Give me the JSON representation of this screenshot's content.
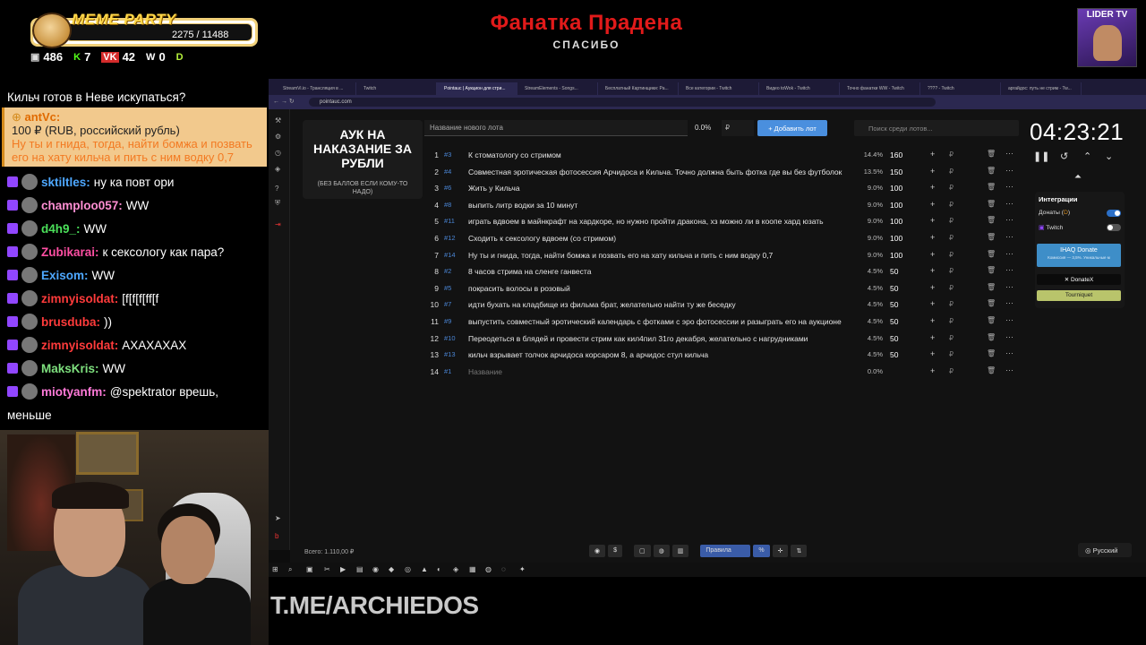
{
  "overlay": {
    "meme_title": "MEME PARTY",
    "meme_count": "2275 / 11488",
    "stats": [
      {
        "icon": "chat-icon",
        "value": "486"
      },
      {
        "icon": "kick-icon",
        "value": "7"
      },
      {
        "icon": "vk-icon",
        "value": "42"
      },
      {
        "icon": "w-icon",
        "value": "0"
      }
    ],
    "title": "Фанатка Прадена",
    "subtitle": "СПАСИБО",
    "channel": "LIDER TV",
    "watermark": "T.ME/ARCHIEDOS"
  },
  "chat": {
    "top_line": "Кильч готов в Неве искупаться?",
    "donation": {
      "name": "antVc:",
      "amount": "100 ₽ (RUB, российский рубль)",
      "message": "Ну ты и гнида, тогда, найти бомжа и позвать его на хату кильча и пить с ним водку 0,7"
    },
    "messages": [
      {
        "name": "sktiltles:",
        "color": "#4ea8ff",
        "text": "ну ка повт ори"
      },
      {
        "name": "champloo057:",
        "color": "#ff8fd3",
        "text": "WW"
      },
      {
        "name": "d4h9_:",
        "color": "#4be05a",
        "text": "WW"
      },
      {
        "name": "Zubikarai:",
        "color": "#ff4fa3",
        "text": "к сексологу как пара?"
      },
      {
        "name": "Exisom:",
        "color": "#4ea8ff",
        "text": "WW"
      },
      {
        "name": "zimnyisoldat:",
        "color": "#ff3b3b",
        "text": "[f[f[f[ff[f"
      },
      {
        "name": "brusduba:",
        "color": "#ff3b3b",
        "text": "))"
      },
      {
        "name": "zimnyisoldat:",
        "color": "#ff3b3b",
        "text": "АХАХАХАХ"
      },
      {
        "name": "MaksKris:",
        "color": "#7ee07e",
        "text": "WW"
      },
      {
        "name": "miotyanfm:",
        "color": "#ff7ad9",
        "text": "@spektrator врешь,"
      }
    ],
    "tail": "меньше"
  },
  "browser": {
    "tabs": [
      "StreamVi.io - Трансляция в ...",
      "Twitch",
      "Pointauc | Аукцион для стри...",
      "StreamElements - Songs...",
      "Бесплатный Картинщики: Ра...",
      "Все категории - Twitch",
      "Видео toWok - Twitch",
      "Точно фанатки WW - Twitch",
      "???? - Twitch",
      "аргайдос: путь не стрим - Tw..."
    ],
    "url": "pointauc.com"
  },
  "auction": {
    "card_title": "АУК НА НАКАЗАНИЕ ЗА РУБЛИ",
    "card_sub": "(БЕЗ БАЛЛОВ ЕСЛИ КОМУ-ТО НАДО)",
    "new_lot_placeholder": "Название нового лота",
    "percent": "0.0%",
    "currency": "₽",
    "add_button": "Добавить лот",
    "search_placeholder": "Поиск среди лотов...",
    "lots": [
      {
        "n": "1",
        "id": "#3",
        "title": "К стоматологу со стримом",
        "pct": "14.4%",
        "amount": "160"
      },
      {
        "n": "2",
        "id": "#4",
        "title": "Совместная эротическая фотосессия Арчидоса и Кильча. Точно должна быть фотка где вы без футболок",
        "pct": "13.5%",
        "amount": "150"
      },
      {
        "n": "3",
        "id": "#6",
        "title": "Жить у Кильча",
        "pct": "9.0%",
        "amount": "100"
      },
      {
        "n": "4",
        "id": "#8",
        "title": "выпить литр водки за 10 минут",
        "pct": "9.0%",
        "amount": "100"
      },
      {
        "n": "5",
        "id": "#11",
        "title": "играть вдвоем в майнкрафт на хардкоре, но нужно пройти дракона, хз можно ли в коопе хард юзать",
        "pct": "9.0%",
        "amount": "100"
      },
      {
        "n": "6",
        "id": "#12",
        "title": "Сходить к сексологу вдвоем (со стримом)",
        "pct": "9.0%",
        "amount": "100"
      },
      {
        "n": "7",
        "id": "#14",
        "title": "Ну ты и гнида, тогда, найти бомжа и позвать его на хату кильча и пить с ним водку 0,7",
        "pct": "9.0%",
        "amount": "100"
      },
      {
        "n": "8",
        "id": "#2",
        "title": "8 часов стрима на сленге ганвеста",
        "pct": "4.5%",
        "amount": "50"
      },
      {
        "n": "9",
        "id": "#5",
        "title": "покрасить волосы в розовый",
        "pct": "4.5%",
        "amount": "50"
      },
      {
        "n": "10",
        "id": "#7",
        "title": "идти бухать на кладбище из фильма брат, желательно найти ту же беседку",
        "pct": "4.5%",
        "amount": "50"
      },
      {
        "n": "11",
        "id": "#9",
        "title": "выпустить совместный эротический календарь с фотками с эро фотосессии и разыграть его на аукционе",
        "pct": "4.5%",
        "amount": "50"
      },
      {
        "n": "12",
        "id": "#10",
        "title": "Переодеться в блядей и провести стрим как кил4пил 31го декабря, желательно с нагрудниками",
        "pct": "4.5%",
        "amount": "50"
      },
      {
        "n": "13",
        "id": "#13",
        "title": "кильч взрывает толчок арчидоса корсаром 8, а арчидос стул кильча",
        "pct": "4.5%",
        "amount": "50"
      },
      {
        "n": "14",
        "id": "#1",
        "title": "Название",
        "pct": "0.0%",
        "amount": ""
      }
    ],
    "timer": "04:23:21",
    "integrations": {
      "title": "Интеграции",
      "donations": "Донаты (",
      "twitch": "Twitch",
      "ihaq": "IHAQ Donate",
      "ihaq_sub": "Комиссия — 3,5%. Уникальные м",
      "donatex": "DonateX",
      "tourniquet": "Tourniquet"
    },
    "total": "Всего: 1.110,00 ₽",
    "rules": "Правила",
    "language": "Русский"
  }
}
